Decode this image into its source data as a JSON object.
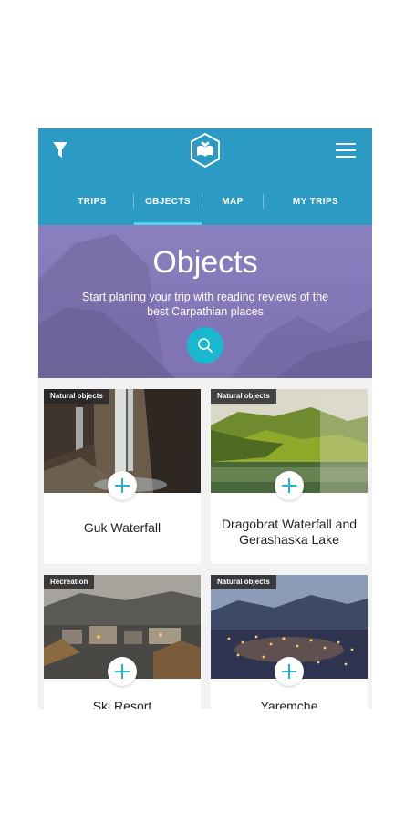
{
  "header": {
    "tabs": [
      {
        "label": "TRIPS"
      },
      {
        "label": "OBJECTS"
      },
      {
        "label": "MAP"
      },
      {
        "label": "MY TRIPS"
      }
    ],
    "active_tab": "OBJECTS"
  },
  "hero": {
    "title": "Objects",
    "subtitle": "Start planing your trip with reading reviews of the best Carpathian places"
  },
  "cards": [
    {
      "badge": "Natural objects",
      "title": "Guk Waterfall"
    },
    {
      "badge": "Natural objects",
      "title": "Dragobrat Waterfall and Gerashaska Lake"
    },
    {
      "badge": "Recreation",
      "title": "Ski Resort"
    },
    {
      "badge": "Natural objects",
      "title": "Yaremche"
    }
  ],
  "colors": {
    "header": "#2b9ac4",
    "accent": "#1ab8cf",
    "hero_overlay": "#7f73b4"
  },
  "icons": {
    "filter": "filter-icon",
    "logo": "book-heart-logo-icon",
    "menu": "hamburger-menu-icon",
    "search": "search-icon",
    "add": "plus-icon"
  }
}
